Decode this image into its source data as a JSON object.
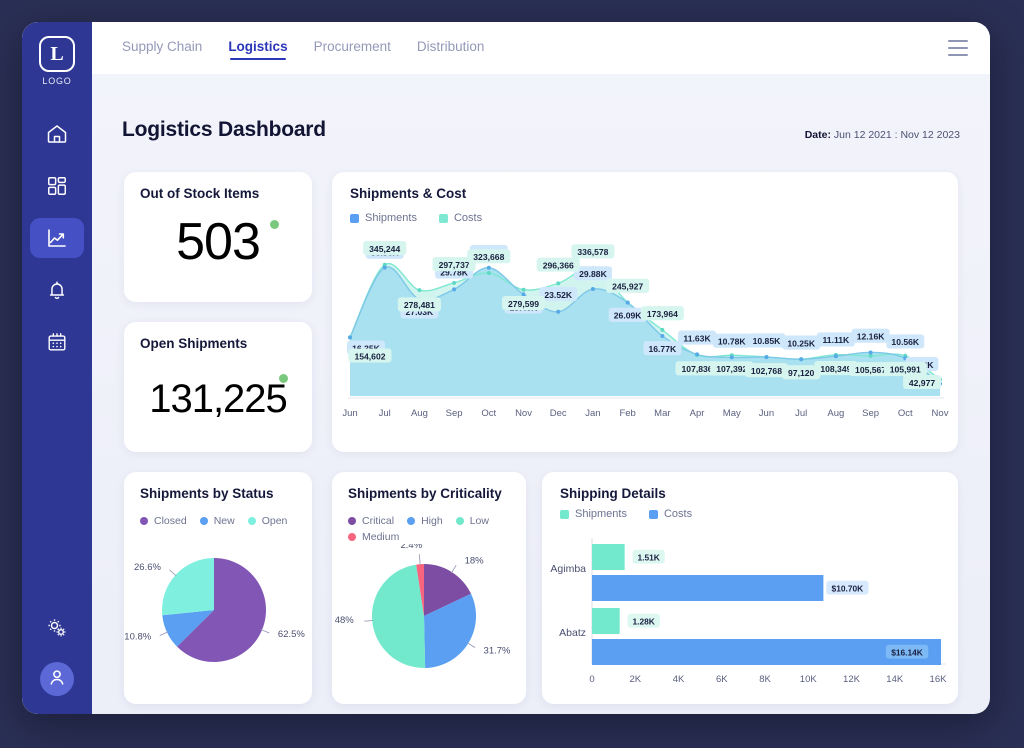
{
  "app": {
    "logo_letter": "L",
    "logo_label": "LOGO"
  },
  "sidebar": {
    "items": [
      {
        "name": "home-icon",
        "label": "Home",
        "active": false
      },
      {
        "name": "dashboard-grid-icon",
        "label": "Dashboards",
        "active": false
      },
      {
        "name": "analytics-chart-icon",
        "label": "Analytics",
        "active": true
      },
      {
        "name": "bell-icon",
        "label": "Notifications",
        "active": false
      },
      {
        "name": "calendar-icon",
        "label": "Calendar",
        "active": false
      }
    ],
    "bottom": [
      {
        "name": "settings-gears-icon",
        "label": "Settings"
      },
      {
        "name": "user-avatar-icon",
        "label": "Account"
      }
    ]
  },
  "topbar": {
    "tabs": [
      {
        "label": "Supply Chain",
        "active": false
      },
      {
        "label": "Logistics",
        "active": true
      },
      {
        "label": "Procurement",
        "active": false
      },
      {
        "label": "Distribution",
        "active": false
      }
    ],
    "menu_icon": "hamburger-icon"
  },
  "header": {
    "title": "Logistics Dashboard",
    "date_label": "Date:",
    "date_value": "Jun 12 2021 : Nov 12 2023"
  },
  "kpis": [
    {
      "label": "Out of Stock Items",
      "value": "503",
      "status_color": "#79c87e"
    },
    {
      "label": "Open Shipments",
      "value": "131,225",
      "status_color": "#79c87e"
    }
  ],
  "cards": {
    "line": {
      "title": "Shipments & Cost"
    },
    "status": {
      "title": "Shipments by Status"
    },
    "criticality": {
      "title": "Shipments by Criticality"
    },
    "shipping": {
      "title": "Shipping Details"
    }
  },
  "colors": {
    "shipments_blue": "#5a9ff2",
    "costs_teal": "#7fe8d2",
    "area_blue": "#a8e0f0",
    "area_teal": "#cdf4ee",
    "closed_purple": "#8156b4",
    "new_blue": "#5a9ff2",
    "open_mint": "#7ff0df",
    "critical_purple": "#7c4da3",
    "high_blue": "#5a9ff2",
    "low_mint": "#72e8cc",
    "medium_pink": "#f9657f",
    "sidebar": "#2f3794",
    "accent": "#2b37b8"
  },
  "chart_data": [
    {
      "id": "shipments-and-cost",
      "type": "line",
      "title": "Shipments & Cost",
      "xlabel": "",
      "ylabel": "",
      "grid": false,
      "legend_position": "top-left",
      "categories": [
        "Jun",
        "Jul",
        "Aug",
        "Sep",
        "Oct",
        "Nov",
        "Dec",
        "Jan",
        "Feb",
        "Mar",
        "Apr",
        "May",
        "Jun",
        "Jul",
        "Aug",
        "Sep",
        "Oct",
        "Nov"
      ],
      "series": [
        {
          "name": "Shipments",
          "color": "#5a9ff2",
          "labels": [
            "16.35K",
            "35.86K",
            "27.03K",
            "29.78K",
            "35.82K",
            "28.40K",
            "23.52K",
            "29.88K",
            "26.09K",
            "16.77K",
            "11.63K",
            "10.78K",
            "10.85K",
            "10.25K",
            "11.11K",
            "12.16K",
            "10.56K",
            "3.42K"
          ],
          "values": [
            16350,
            35860,
            27030,
            29780,
            35820,
            28400,
            23520,
            29880,
            26090,
            16770,
            11630,
            10780,
            10850,
            10250,
            11110,
            12160,
            10560,
            3420
          ]
        },
        {
          "name": "Costs",
          "color": "#7fe8d2",
          "labels": [
            "154,602",
            "345,244",
            "278,481",
            "297,737",
            "323,668",
            "279,599",
            "296,366",
            "336,578",
            "245,927",
            "173,964",
            "107,836",
            "107,392",
            "102,768",
            "97,120",
            "108,349",
            "105,567",
            "105,991",
            "42,977"
          ],
          "values": [
            154602,
            345244,
            278481,
            297737,
            323668,
            279599,
            296366,
            336578,
            245927,
            173964,
            107836,
            107392,
            102768,
            97120,
            108349,
            105567,
            105991,
            42977
          ]
        }
      ]
    },
    {
      "id": "shipments-by-status",
      "type": "pie",
      "title": "Shipments by Status",
      "legend_position": "top",
      "slices": [
        {
          "label": "Closed",
          "value": 62.5,
          "display": "62.5%",
          "color": "#8156b4"
        },
        {
          "label": "New",
          "value": 10.8,
          "display": "10.8%",
          "color": "#5a9ff2"
        },
        {
          "label": "Open",
          "value": 26.6,
          "display": "26.6%",
          "color": "#7ff0df"
        }
      ]
    },
    {
      "id": "shipments-by-criticality",
      "type": "pie",
      "title": "Shipments by Criticality",
      "legend_position": "top",
      "slices": [
        {
          "label": "Critical",
          "value": 18.0,
          "display": "18%",
          "color": "#7c4da3"
        },
        {
          "label": "High",
          "value": 31.7,
          "display": "31.7%",
          "color": "#5a9ff2"
        },
        {
          "label": "Low",
          "value": 48.0,
          "display": "48%",
          "color": "#72e8cc"
        },
        {
          "label": "Medium",
          "value": 2.4,
          "display": "2.4%",
          "color": "#f9657f"
        }
      ]
    },
    {
      "id": "shipping-details",
      "type": "bar",
      "orientation": "horizontal",
      "title": "Shipping Details",
      "legend_position": "top-left",
      "categories": [
        "Agimba",
        "Abatz"
      ],
      "xlim": [
        0,
        16000
      ],
      "xticks": [
        "0",
        "2K",
        "4K",
        "6K",
        "8K",
        "10K",
        "12K",
        "14K",
        "16K"
      ],
      "xtick_values": [
        0,
        2000,
        4000,
        6000,
        8000,
        10000,
        12000,
        14000,
        16000
      ],
      "series": [
        {
          "name": "Shipments",
          "color": "#72e8cc",
          "values": [
            1510,
            1280
          ],
          "labels": [
            "1.51K",
            "1.28K"
          ]
        },
        {
          "name": "Costs",
          "color": "#5a9ff2",
          "values": [
            10700,
            16140
          ],
          "labels": [
            "$10.70K",
            "$16.14K"
          ]
        }
      ]
    }
  ]
}
